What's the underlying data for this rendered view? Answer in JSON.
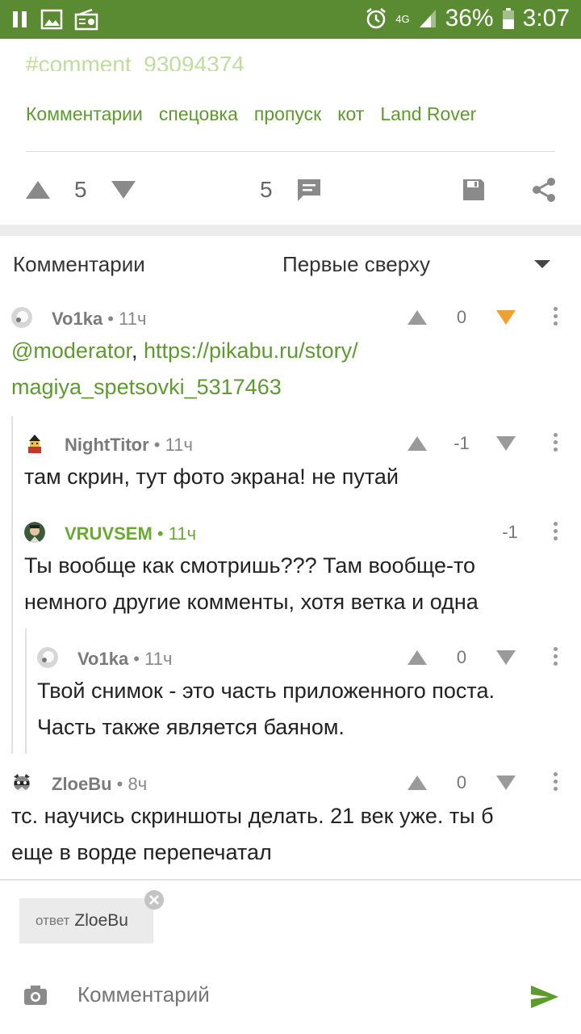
{
  "status_bar": {
    "battery_percent": "36%",
    "time": "3:07",
    "network": "4G"
  },
  "post": {
    "anchor_text": "#comment_93094374",
    "tags": [
      "Комментарии",
      "спецовка",
      "пропуск",
      "кот",
      "Land Rover"
    ],
    "rating": "5",
    "comments_count": "5"
  },
  "comments_section": {
    "title": "Комментарии",
    "sort_value": "Первые сверху"
  },
  "comments": [
    {
      "author": "Vo1ka",
      "time": "11ч",
      "score": "0",
      "mention": "@moderator",
      "separator": ", ",
      "link": "https://pikabu.ru/story/magiya_spetsovki_5317463",
      "link_line1": "https://pikabu.ru/story/",
      "link_line2": "magiya_spetsovki_5317463",
      "downvoted": true
    },
    {
      "author": "NightTitor",
      "time": "11ч",
      "score": "-1",
      "text": "там скрин, тут фото экрана! не путай"
    },
    {
      "author": "VRUVSEM",
      "time": "11ч",
      "score": "-1",
      "line1": "Ты вообще как смотришь??? Там вообще-то",
      "line2": "немного другие комменты, хотя ветка и одна"
    },
    {
      "author": "Vo1ka",
      "time": "11ч",
      "score": "0",
      "line1": "Твой снимок - это часть приложенного поста.",
      "line2": "Часть также является баяном."
    },
    {
      "author": "ZloeBu",
      "time": "8ч",
      "score": "0",
      "line1": "тс. научись скриншоты делать. 21 век уже. ты б",
      "line2": "еще в ворде перепечатал"
    }
  ],
  "composer": {
    "reply_label": "ответ",
    "reply_to": "ZloeBu",
    "placeholder": "Комментарий"
  },
  "colors": {
    "status_bar": "#5a8a32",
    "accent_green": "#5d9b2e",
    "downvote_active": "#f0a030",
    "icon_gray": "#9a9a9a"
  }
}
